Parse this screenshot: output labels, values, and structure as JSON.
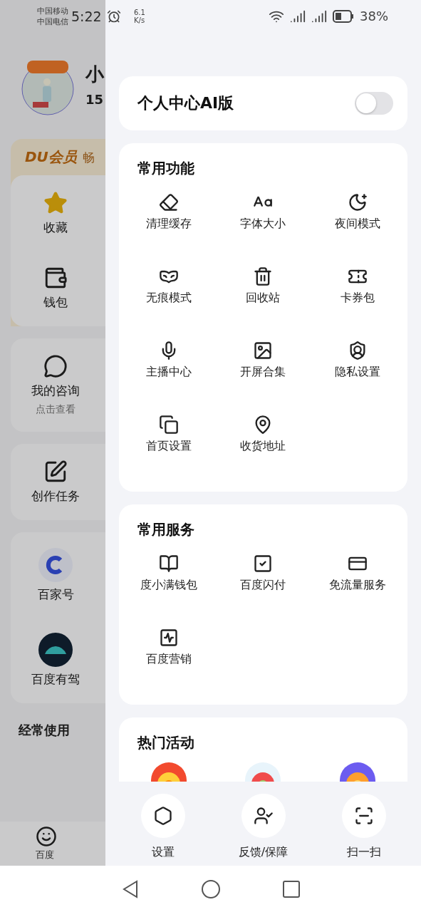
{
  "status_bar": {
    "carriers": [
      "中国移动",
      "中国电信"
    ],
    "time": "5:22",
    "net_speed": [
      "6.1",
      "K/s"
    ],
    "battery": "38%"
  },
  "background_page": {
    "profile": {
      "name": "小",
      "number": "15"
    },
    "member": {
      "badge": "DU会员",
      "text": "畅"
    },
    "cards": [
      {
        "items": [
          {
            "label": "收藏"
          },
          {
            "label": "钱包"
          }
        ]
      },
      {
        "items": [
          {
            "label": "我的咨询",
            "sub": "点击查看"
          }
        ]
      },
      {
        "items": [
          {
            "label": "创作任务"
          }
        ]
      },
      {
        "items": [
          {
            "label": "百家号"
          },
          {
            "label": "百度有驾"
          }
        ]
      }
    ],
    "frequent_title": "经常使用",
    "tab": {
      "label": "百度"
    }
  },
  "drawer": {
    "ai_toggle": {
      "label": "个人中心AI版",
      "on": false
    },
    "sections": [
      {
        "title": "常用功能",
        "items": [
          {
            "label": "清理缓存"
          },
          {
            "label": "字体大小"
          },
          {
            "label": "夜间模式"
          },
          {
            "label": "无痕模式"
          },
          {
            "label": "回收站"
          },
          {
            "label": "卡券包"
          },
          {
            "label": "主播中心"
          },
          {
            "label": "开屏合集"
          },
          {
            "label": "隐私设置"
          },
          {
            "label": "首页设置"
          },
          {
            "label": "收货地址"
          }
        ]
      },
      {
        "title": "常用服务",
        "items": [
          {
            "label": "度小满钱包"
          },
          {
            "label": "百度闪付"
          },
          {
            "label": "免流量服务"
          },
          {
            "label": "百度营销"
          }
        ]
      }
    ],
    "hot": {
      "title": "热门活动"
    },
    "actions": [
      {
        "label": "设置"
      },
      {
        "label": "反馈/保障"
      },
      {
        "label": "扫一扫"
      }
    ]
  }
}
